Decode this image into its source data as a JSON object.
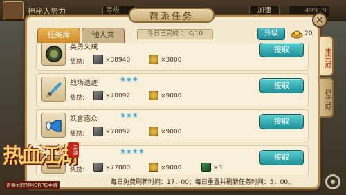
{
  "background": {
    "top_left_text": "神秘人势力",
    "search_label": "等级",
    "speedup_label": "加速",
    "currency": "49919"
  },
  "dialog": {
    "title": "帮派任务",
    "tabs": [
      {
        "label": "任务库",
        "active": true
      },
      {
        "label": "他人共享",
        "active": false
      }
    ],
    "completed_today": "今日已完成 ： 0/10",
    "upgrade_button": "升级",
    "ingot_count": "20",
    "side_tabs": [
      {
        "label": "未完成",
        "active": true
      },
      {
        "label": "已完成",
        "active": false
      }
    ],
    "reward_label": "奖励:",
    "accept_label": "接取",
    "tasks": [
      {
        "name": "英勇义贼",
        "stars": 0,
        "reward1": "×38940",
        "reward2": "×3000",
        "reward3": "",
        "icon": "round-emblem-icon"
      },
      {
        "name": "战场遗迹",
        "stars": 3,
        "reward1": "×70092",
        "reward2": "×9000",
        "reward3": "",
        "icon": "sword-icon"
      },
      {
        "name": "妖言惑众",
        "stars": 3,
        "reward1": "×70092",
        "reward2": "×9000",
        "reward3": "",
        "icon": "horn-icon"
      },
      {
        "name": "",
        "stars": 4,
        "reward1": "×77880",
        "reward2": "×9000",
        "reward3": "×3",
        "icon": "scroll-icon"
      }
    ],
    "footer": "每日免费刷新时间：17：00；每日重置并刷新任务时间：5：00。"
  },
  "logo": {
    "title": "热血江湖",
    "seal": "手游",
    "subtitle": "青春武侠MMORPG手游"
  },
  "colors": {
    "accent": "#1f9098",
    "star": "#3fa8e0",
    "active_tab": "#d08a28"
  }
}
